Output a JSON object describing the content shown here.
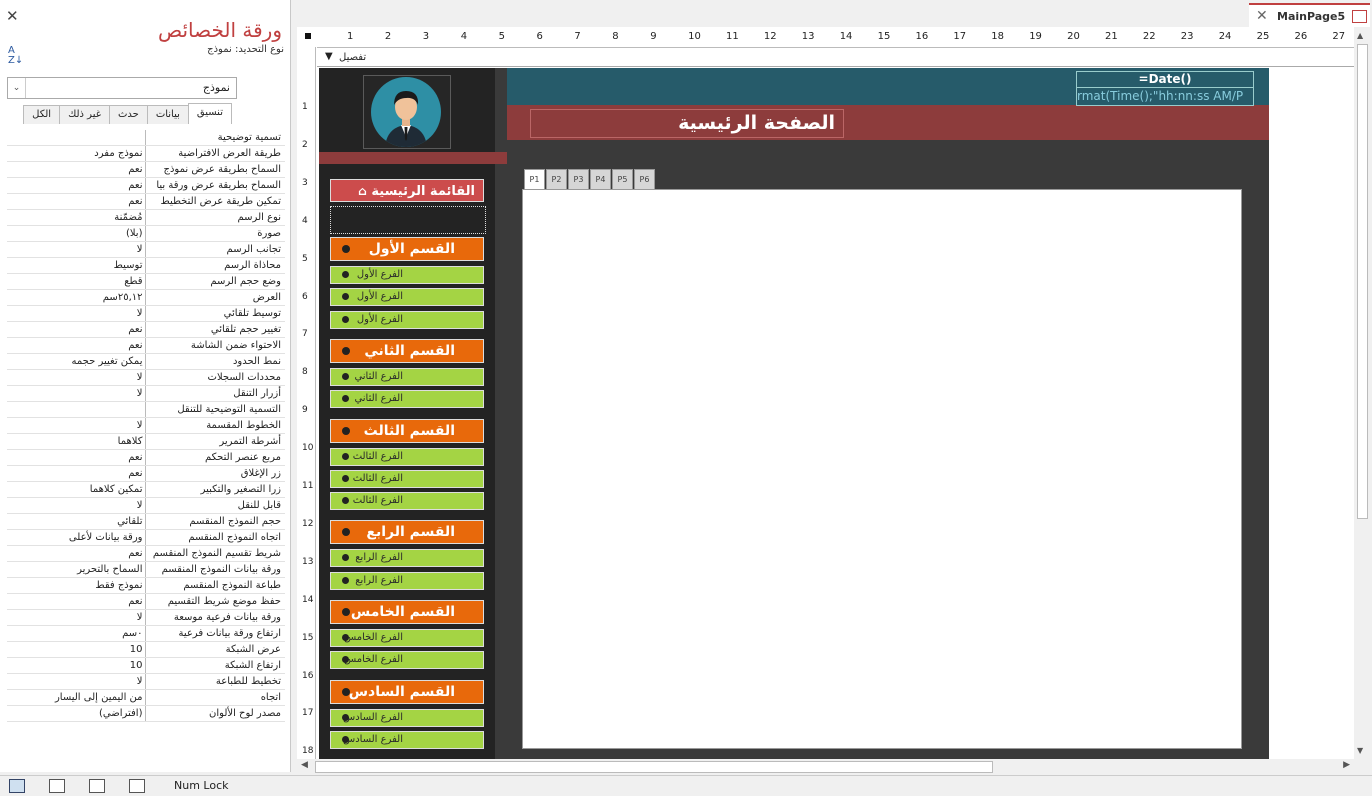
{
  "property_sheet": {
    "title": "ورقة الخصائص",
    "selection_type_label": "نوع التحديد:",
    "selection_type_value": "نموذج",
    "object_selector": "نموذج",
    "tabs": [
      "تنسيق",
      "بيانات",
      "حدث",
      "غير ذلك",
      "الكل"
    ],
    "active_tab": "تنسيق",
    "rows": [
      {
        "k": "تسمية توضيحية",
        "v": ""
      },
      {
        "k": "طريقة العرض الافتراضية",
        "v": "نموذج مفرد"
      },
      {
        "k": "السماح بطريقة عرض نموذج",
        "v": "نعم"
      },
      {
        "k": "السماح بطريقة عرض ورقة بيا",
        "v": "نعم"
      },
      {
        "k": "تمكين طريقة عرض التخطيط",
        "v": "نعم"
      },
      {
        "k": "نوع الرسم",
        "v": "مُضمّنة"
      },
      {
        "k": "صورة",
        "v": "(بلا)"
      },
      {
        "k": "تجانب الرسم",
        "v": "لا"
      },
      {
        "k": "محاذاة الرسم",
        "v": "توسيط"
      },
      {
        "k": "وضع حجم الرسم",
        "v": "قطع"
      },
      {
        "k": "العرض",
        "v": "٢٥,١٢سم"
      },
      {
        "k": "توسيط تلقائي",
        "v": "لا"
      },
      {
        "k": "تغيير حجم تلقائي",
        "v": "نعم"
      },
      {
        "k": "الاحتواء ضمن الشاشة",
        "v": "نعم"
      },
      {
        "k": "نمط الحدود",
        "v": "يمكن تغيير حجمه"
      },
      {
        "k": "محددات السجلات",
        "v": "لا"
      },
      {
        "k": "أزرار التنقل",
        "v": "لا"
      },
      {
        "k": "التسمية التوضيحية للتنقل",
        "v": ""
      },
      {
        "k": "الخطوط المقسمة",
        "v": "لا"
      },
      {
        "k": "أشرطة التمرير",
        "v": "كلاهما"
      },
      {
        "k": "مربع عنصر التحكم",
        "v": "نعم"
      },
      {
        "k": "زر الإغلاق",
        "v": "نعم"
      },
      {
        "k": "زرا التصغير والتكبير",
        "v": "تمكين كلاهما"
      },
      {
        "k": "قابل للنقل",
        "v": "لا"
      },
      {
        "k": "حجم النموذج المنقسم",
        "v": "تلقائي"
      },
      {
        "k": "اتجاه النموذج المنقسم",
        "v": "ورقة بيانات لأعلى"
      },
      {
        "k": "شريط تقسيم النموذج المنقسم",
        "v": "نعم"
      },
      {
        "k": "ورقة بيانات النموذج المنقسم",
        "v": "السماح بالتحرير"
      },
      {
        "k": "طباعة النموذج المنقسم",
        "v": "نموذج فقط"
      },
      {
        "k": "حفظ موضع شريط التقسيم",
        "v": "نعم"
      },
      {
        "k": "ورقة بيانات فرعية موسعة",
        "v": "لا"
      },
      {
        "k": "ارتفاع ورقة بيانات فرعية",
        "v": "٠سم"
      },
      {
        "k": "عرض الشبكة",
        "v": "10"
      },
      {
        "k": "ارتفاع الشبكة",
        "v": "10"
      },
      {
        "k": "تخطيط للطباعة",
        "v": "لا"
      },
      {
        "k": "اتجاه",
        "v": "من اليمين إلى اليسار"
      },
      {
        "k": "مصدر لوح الألوان",
        "v": "(افتراضي)"
      }
    ]
  },
  "document_tab": {
    "label": "MainPage5"
  },
  "section_label": "تفصيل",
  "form": {
    "date_expr": "=Date()",
    "time_expr": "rmat(Time();\"hh:nn:ss AM/P",
    "page_title": "الصفحة الرئيسية",
    "menu_title": "القائمة الرئيسية",
    "sections": [
      {
        "title": "القسم الأول",
        "subs": [
          "الفرع الأول",
          "الفرع الأول",
          "الفرع الأول"
        ]
      },
      {
        "title": "القسم الثاني",
        "subs": [
          "الفرع الثاني",
          "الفرع الثاني"
        ]
      },
      {
        "title": "القسم الثالث",
        "subs": [
          "الفرع الثالث",
          "الفرع الثالث",
          "الفرع الثالث"
        ]
      },
      {
        "title": "القسم الرابع",
        "subs": [
          "الفرع الرابع",
          "الفرع الرابع"
        ]
      },
      {
        "title": "القسم الخامس",
        "subs": [
          "الفرع الخامس",
          "الفرع الخامس"
        ]
      },
      {
        "title": "القسم السادس",
        "subs": [
          "الفرع السادس",
          "الفرع السادس"
        ]
      }
    ],
    "page_tabs": [
      "P1",
      "P2",
      "P3",
      "P4",
      "P5",
      "P6"
    ],
    "active_page_tab": "P1"
  },
  "ruler": {
    "h": [
      "1",
      "2",
      "3",
      "4",
      "5",
      "6",
      "7",
      "8",
      "9",
      "10",
      "11",
      "12",
      "13",
      "14",
      "15",
      "16",
      "17",
      "18",
      "19",
      "20",
      "21",
      "22",
      "23",
      "24",
      "25",
      "26",
      "27"
    ],
    "v": [
      "1",
      "2",
      "3",
      "4",
      "5",
      "6",
      "7",
      "8",
      "9",
      "10",
      "11",
      "12",
      "13",
      "14",
      "15",
      "16",
      "17",
      "18"
    ]
  },
  "status": {
    "num_lock": "Num Lock"
  },
  "colors": {
    "orange": "#e8690b",
    "green": "#a4d444",
    "maroon": "#8d3c3c",
    "teal": "#265b6a"
  }
}
